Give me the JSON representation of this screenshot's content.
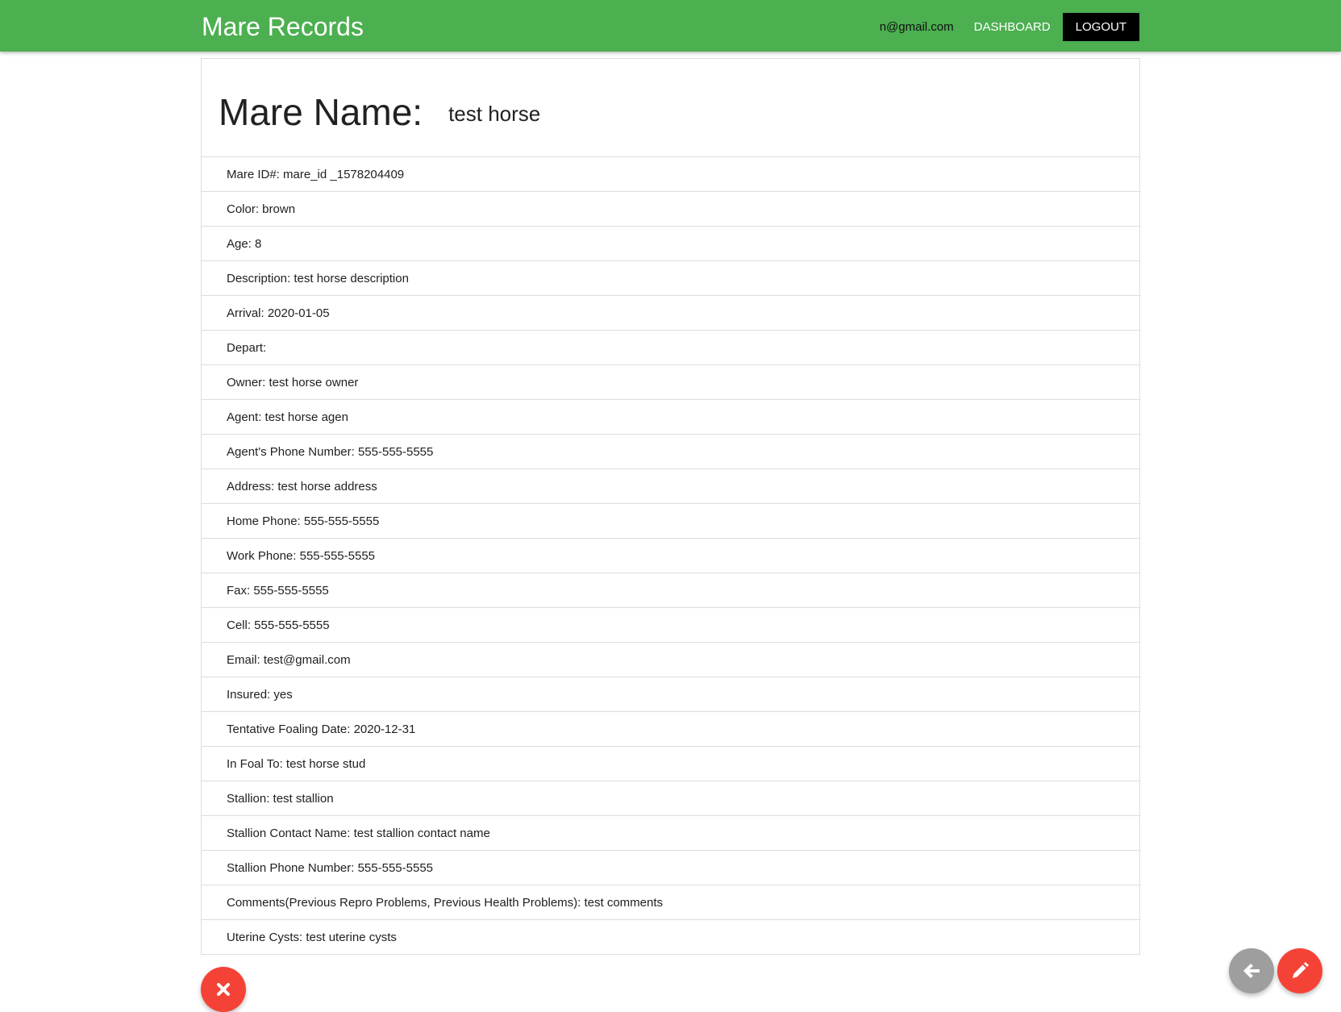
{
  "navbar": {
    "brand": "Mare Records",
    "email": "n@gmail.com",
    "dashboard_label": "DASHBOARD",
    "logout_label": "LOGOUT",
    "color": "#4caf50"
  },
  "mare": {
    "name_label": "Mare Name:",
    "name_value": "test horse",
    "fields": [
      "Mare ID#: mare_id _1578204409",
      "Color: brown",
      "Age: 8",
      "Description: test horse description",
      "Arrival: 2020-01-05",
      "Depart:",
      "Owner: test horse owner",
      "Agent: test horse agen",
      "Agent's Phone Number: 555-555-5555",
      "Address: test horse address",
      "Home Phone: 555-555-5555",
      "Work Phone: 555-555-5555",
      "Fax: 555-555-5555",
      "Cell: 555-555-5555",
      "Email: test@gmail.com",
      "Insured: yes",
      "Tentative Foaling Date: 2020-12-31",
      "In Foal To: test horse stud",
      "Stallion: test stallion",
      "Stallion Contact Name: test stallion contact name",
      "Stallion Phone Number: 555-555-5555",
      "Comments(Previous Repro Problems, Previous Health Problems): test comments",
      "Uterine Cysts: test uterine cysts"
    ]
  },
  "actions": {
    "delete_icon": "close-icon",
    "back_icon": "arrow-left-icon",
    "edit_icon": "pencil-icon",
    "delete_color": "#f44336",
    "back_color": "#9e9e9e",
    "edit_color": "#f44336"
  }
}
